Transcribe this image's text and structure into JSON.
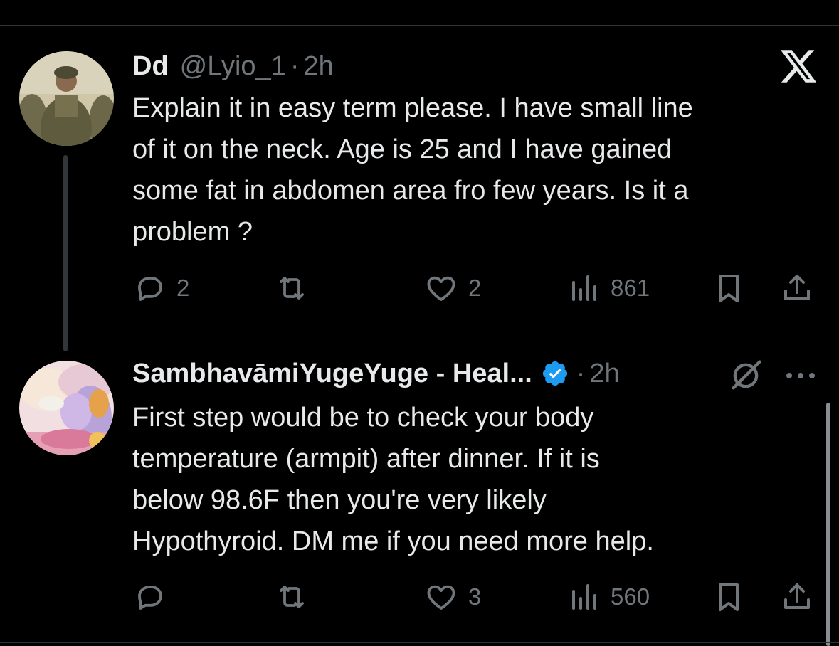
{
  "tweets": [
    {
      "name": "Dd",
      "handle": "@Lyio_1",
      "separator": "·",
      "time": "2h",
      "lines": [
        "Explain it in easy term please. I have small line",
        "of it on the neck. Age is 25 and I have gained",
        "some fat in abdomen area fro few years. Is it a",
        "problem ?"
      ],
      "replies": "2",
      "retweets": "",
      "likes": "2",
      "views": "861"
    },
    {
      "name": "SambhavāmiYugeYuge - Heal...",
      "verified": true,
      "separator": "·",
      "time": "2h",
      "lines": [
        "First step would be to check your body",
        "temperature (armpit) after dinner. If it is",
        "below 98.6F then you're very likely",
        "Hypothyroid. DM me if you need more help."
      ],
      "replies": "",
      "retweets": "",
      "likes": "3",
      "views": "560"
    }
  ],
  "icons": {
    "logo": "x-logo-icon",
    "reply": "reply-icon",
    "retweet": "retweet-icon",
    "like": "heart-icon",
    "views": "views-icon",
    "bookmark": "bookmark-icon",
    "share": "share-icon",
    "grok": "grok-icon",
    "more": "more-icon",
    "verified": "verified-badge-icon"
  },
  "colors": {
    "background": "#000000",
    "text": "#e7e9ea",
    "muted": "#71767b",
    "verified": "#1d9bf0"
  }
}
